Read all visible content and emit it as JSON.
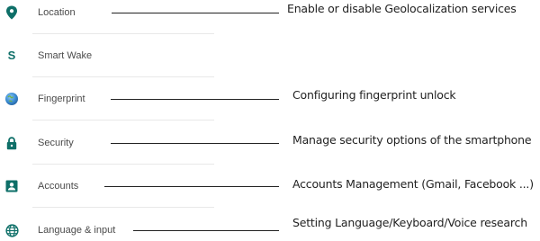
{
  "settings_items": [
    {
      "label": "Location",
      "icon": "location-pin-icon",
      "annotation": "Enable or disable Geolocalization services"
    },
    {
      "label": "Smart Wake",
      "icon": "smart-wake-s-icon",
      "icon_glyph": "S",
      "annotation": ""
    },
    {
      "label": "Fingerprint",
      "icon": "fingerprint-globe-icon",
      "annotation": "Configuring fingerprint unlock"
    },
    {
      "label": "Security",
      "icon": "lock-icon",
      "annotation": "Manage security options of the smartphone"
    },
    {
      "label": "Accounts",
      "icon": "account-box-icon",
      "annotation": "Accounts Management (Gmail, Facebook ...)"
    },
    {
      "label": "Language & input",
      "icon": "globe-icon",
      "annotation": "Setting Language/Keyboard/Voice research"
    }
  ],
  "colors": {
    "icon_teal": "#0e6f68",
    "label_text": "#4a4a4a",
    "annotation_text": "#222222",
    "divider": "#e8e8e8",
    "fingerprint_blue": "#3d8fd6"
  }
}
